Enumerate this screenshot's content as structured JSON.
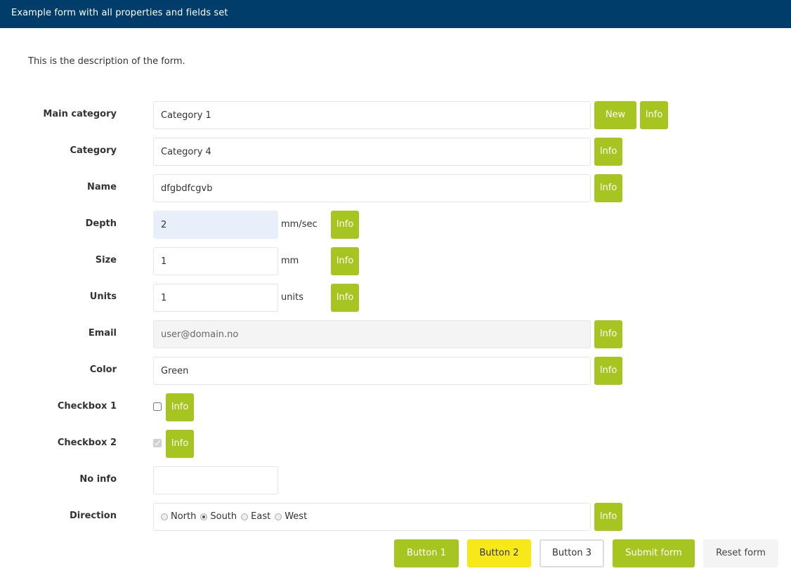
{
  "header": {
    "title": "Example form with all properties and fields set"
  },
  "description": "This is the description of the form.",
  "fields": {
    "main_category": {
      "label": "Main category",
      "value": "Category 1",
      "new_label": "New",
      "info_label": "Info"
    },
    "category": {
      "label": "Category",
      "value": "Category 4",
      "info_label": "Info"
    },
    "name": {
      "label": "Name",
      "value": "dfgbdfcgvb",
      "info_label": "Info"
    },
    "depth": {
      "label": "Depth",
      "value": "2",
      "unit": "mm/sec",
      "info_label": "Info"
    },
    "size": {
      "label": "Size",
      "value": "1",
      "unit": "mm",
      "info_label": "Info"
    },
    "units": {
      "label": "Units",
      "value": "1",
      "unit": "units",
      "info_label": "Info"
    },
    "email": {
      "label": "Email",
      "value": "user@domain.no",
      "info_label": "Info"
    },
    "color": {
      "label": "Color",
      "value": "Green",
      "info_label": "Info"
    },
    "checkbox1": {
      "label": "Checkbox 1",
      "checked": false,
      "info_label": "Info"
    },
    "checkbox2": {
      "label": "Checkbox 2",
      "checked": true,
      "info_label": "Info"
    },
    "no_info": {
      "label": "No info",
      "value": ""
    },
    "direction": {
      "label": "Direction",
      "options": [
        "North",
        "South",
        "East",
        "West"
      ],
      "selected": "South",
      "info_label": "Info"
    }
  },
  "actions": {
    "button1": "Button 1",
    "button2": "Button 2",
    "button3": "Button 3",
    "submit": "Submit form",
    "reset": "Reset form"
  },
  "colors": {
    "header_bg": "#003d6b",
    "accent_green": "#a7c520",
    "accent_yellow": "#f7e81a",
    "focus_bg": "#e8effa"
  }
}
